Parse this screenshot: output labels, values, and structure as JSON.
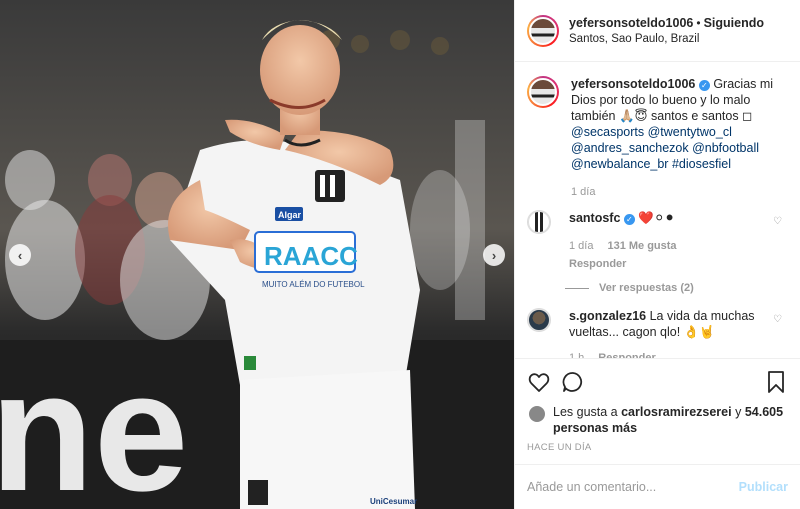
{
  "header": {
    "username": "yefersonsoteldo1006",
    "separator": "•",
    "follow_status": "Siguiendo",
    "location": "Santos, Sao Paulo, Brazil"
  },
  "caption": {
    "username": "yefersonsoteldo1006",
    "text": "Gracias mi Dios por todo lo bueno y lo malo también 🙏🏼😇 santos e santos ◻",
    "mentions": "@secasports @twentytwo_cl @andres_sanchezok @nbfootball @newbalance_br #diosesfiel",
    "time": "1 día"
  },
  "comments": [
    {
      "username": "santosfc",
      "text": "❤️⚪⚫",
      "time": "1 día",
      "likes": "131 Me gusta",
      "reply_label": "Responder",
      "view_replies": "Ver respuestas (2)"
    },
    {
      "username": "s.gonzalez16",
      "text": "La vida da muchas vueltas... cagon qlo! 👌🤘",
      "time": "1 h",
      "reply_label": "Responder"
    }
  ],
  "likes": {
    "prefix": "Les gusta a ",
    "user": "carlosramirezserei",
    "middle": " y ",
    "count": "54.605 personas más"
  },
  "timestamp": "HACE UN DÍA",
  "add_comment": {
    "placeholder": "Añade un comentario...",
    "submit_label": "Publicar"
  },
  "photo": {
    "jersey_text": "RAACC",
    "jersey_subtext": "MUITO ALÉM DO FUTEBOL",
    "sponsor": "Algar",
    "shorts_sponsor": "UniCesumar"
  },
  "icons": {
    "heart": "heart-icon",
    "comment": "comment-icon",
    "bookmark": "bookmark-icon",
    "prev": "chevron-left-icon",
    "next": "chevron-right-icon"
  },
  "colors": {
    "link": "#003569",
    "verified": "#3897f0",
    "muted": "#999999",
    "publish": "#b2dffc"
  }
}
